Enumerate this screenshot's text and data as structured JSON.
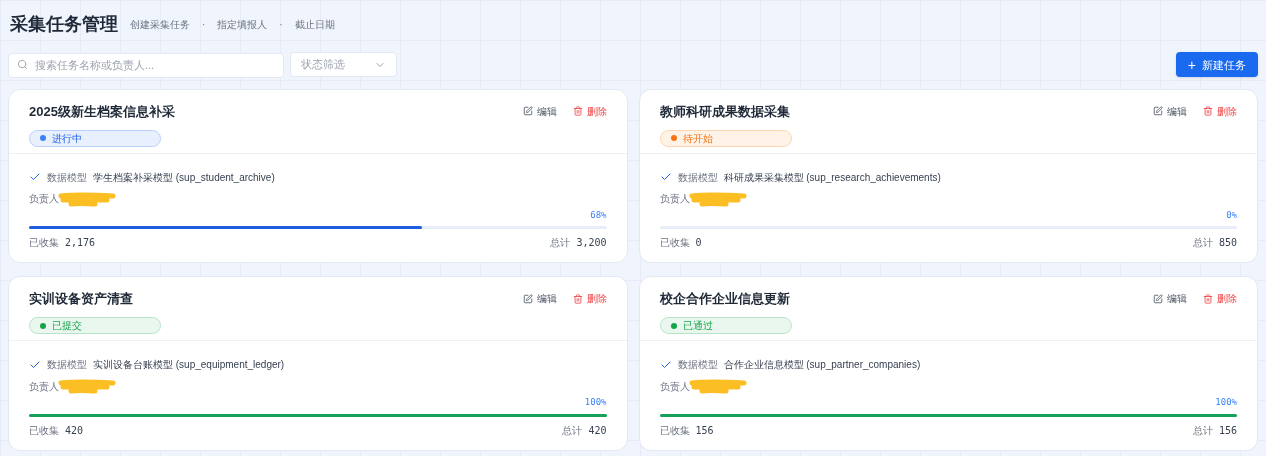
{
  "header": {
    "title": "采集任务管理",
    "subtitle": [
      "创建采集任务",
      "·",
      "指定填报人",
      "·",
      "截止日期"
    ]
  },
  "toolbar": {
    "search": {
      "placeholder": "搜索任务名称或负责人..."
    },
    "status_filter": {
      "placeholder": "状态筛选"
    },
    "new_button": {
      "icon": "+",
      "label": "新建任务"
    }
  },
  "tasks": [
    {
      "title": "2025级新生档案信息补采",
      "status": {
        "kind": "progress",
        "label": "进行中"
      },
      "edit": "编辑",
      "delete": "删除",
      "model_label": "数据模型",
      "model": "学生档案补采模型 (sup_student_archive)",
      "owner_label": "负责人",
      "percent": "68%",
      "level": 0.68,
      "collected_label": "已收集",
      "collected": "2,176",
      "total_label": "总计",
      "total": "3,200"
    },
    {
      "title": "教师科研成果数据采集",
      "status": {
        "kind": "pending",
        "label": "待开始"
      },
      "edit": "编辑",
      "delete": "删除",
      "model_label": "数据模型",
      "model": "科研成果采集模型 (sup_research_achievements)",
      "owner_label": "负责人",
      "percent": "0%",
      "level": 0,
      "collected_label": "已收集",
      "collected": "0",
      "total_label": "总计",
      "total": "850"
    },
    {
      "title": "实训设备资产清查",
      "status": {
        "kind": "submitted",
        "label": "已提交"
      },
      "edit": "编辑",
      "delete": "删除",
      "model_label": "数据模型",
      "model": "实训设备台账模型 (sup_equipment_ledger)",
      "owner_label": "负责人",
      "percent": "100%",
      "level": 1,
      "collected_label": "已收集",
      "collected": "420",
      "total_label": "总计",
      "total": "420"
    },
    {
      "title": "校企合作企业信息更新",
      "status": {
        "kind": "approved",
        "label": "已通过"
      },
      "edit": "编辑",
      "delete": "删除",
      "model_label": "数据模型",
      "model": "合作企业信息模型 (sup_partner_companies)",
      "owner_label": "负责人",
      "percent": "100%",
      "level": 1,
      "collected_label": "已收集",
      "collected": "156",
      "total_label": "总计",
      "total": "156"
    }
  ]
}
